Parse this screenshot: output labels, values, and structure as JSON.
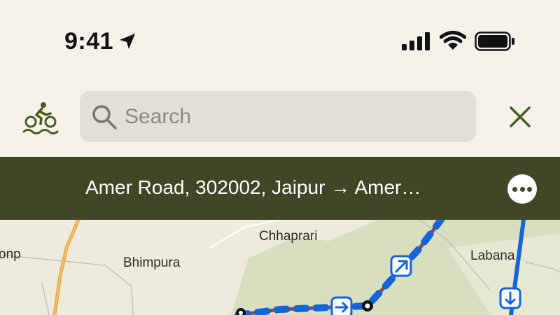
{
  "status_bar": {
    "time": "9:41",
    "icons": [
      "location-arrow-icon",
      "cellular-signal-icon",
      "wifi-icon",
      "battery-icon"
    ]
  },
  "search": {
    "placeholder": "Search",
    "mode_icon": "cycling-icon",
    "close_icon": "close-icon"
  },
  "route": {
    "title": "Amer Road, 302002, Jaipur → Amer…"
  },
  "map": {
    "labels": {
      "chhaprari": "Chhaprari",
      "bhimpura": "Bhimpura",
      "labana": "Labana",
      "onp": "onp"
    }
  },
  "colors": {
    "background": "#f4f2ea",
    "accent": "#3f4726",
    "icon_green": "#4a5d1e",
    "route_blue": "#1565d8",
    "route_red": "#a84230",
    "park_green": "#d8dfc0"
  }
}
